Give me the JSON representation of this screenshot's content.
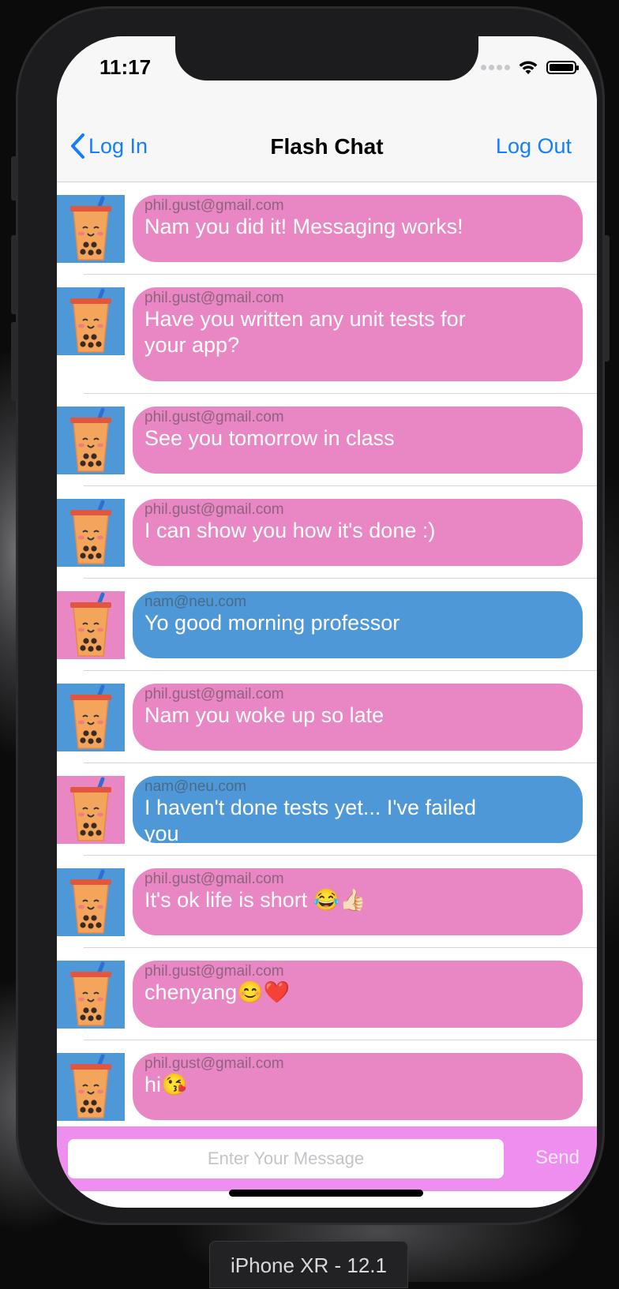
{
  "status_bar": {
    "time": "11:17"
  },
  "nav": {
    "back_label": "Log In",
    "title": "Flash Chat",
    "right_label": "Log Out"
  },
  "messages": [
    {
      "sender": "phil.gust@gmail.com",
      "text": "Nam you did it! Messaging works!",
      "style": "pink"
    },
    {
      "sender": "phil.gust@gmail.com",
      "text": "Have you written any unit tests for your app?",
      "style": "pink"
    },
    {
      "sender": "phil.gust@gmail.com",
      "text": "See you tomorrow in class",
      "style": "pink"
    },
    {
      "sender": "phil.gust@gmail.com",
      "text": "I can show you how it's done :)",
      "style": "pink"
    },
    {
      "sender": "nam@neu.com",
      "text": "Yo good morning professor",
      "style": "blue"
    },
    {
      "sender": "phil.gust@gmail.com",
      "text": "Nam you woke up so late",
      "style": "pink"
    },
    {
      "sender": "nam@neu.com",
      "text": "I haven't done tests yet... I've failed you",
      "style": "blue"
    },
    {
      "sender": "phil.gust@gmail.com",
      "text": "It's ok life is short 😂👍🏻",
      "style": "pink"
    },
    {
      "sender": "phil.gust@gmail.com",
      "text": "chenyang😊❤️",
      "style": "pink"
    },
    {
      "sender": "phil.gust@gmail.com",
      "text": "hi😘",
      "style": "pink"
    }
  ],
  "compose": {
    "placeholder": "Enter Your Message",
    "send_label": "Send"
  },
  "device_label": "iPhone XR - 12.1",
  "colors": {
    "pink_bubble": "#e887c3",
    "blue_bubble": "#4f98d8",
    "avatar_blue_bg": "#4f98d8",
    "avatar_pink_bg": "#e887c3",
    "compose_bar": "#ee8ff0",
    "ios_tint": "#147efb"
  },
  "icons": {
    "back": "chevron-left-icon",
    "wifi": "wifi-icon",
    "battery": "battery-icon",
    "signal": "signal-dots-icon",
    "avatar": "boba-tea-avatar-icon"
  }
}
